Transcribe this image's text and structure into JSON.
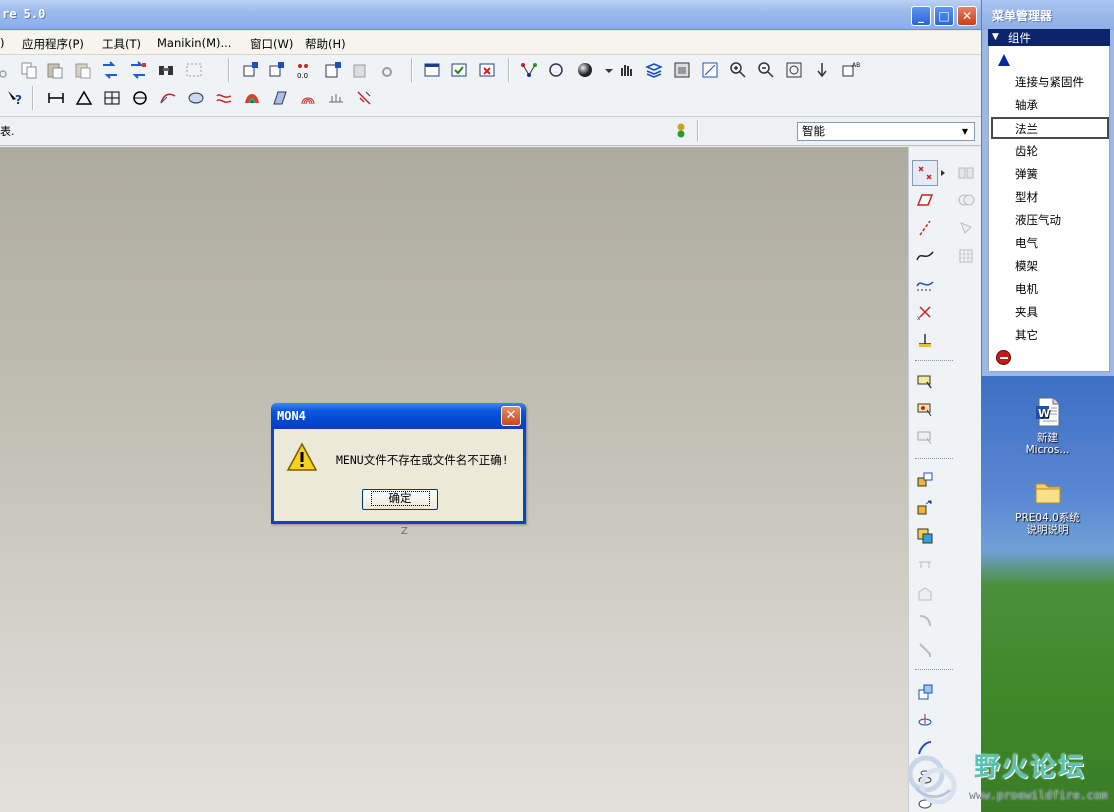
{
  "window": {
    "title": "re 5.0",
    "minimize": "_",
    "maximize": "□",
    "close": "✕"
  },
  "menubar": {
    "items": [
      ")",
      "应用程序(P)",
      "工具(T)",
      "Manikin(M)...",
      "窗口(W)",
      "帮助(H)"
    ]
  },
  "status": {
    "message": "表.",
    "filter_value": "智能"
  },
  "graphics": {
    "axis_label": "Z"
  },
  "dialog": {
    "title": "MON4",
    "message": "MENU文件不存在或文件名不正确!",
    "ok_label": "确定",
    "close": "✕"
  },
  "menu_manager": {
    "title": "菜单管理器",
    "header": "组件",
    "items": [
      "连接与紧固件",
      "轴承",
      "法兰",
      "齿轮",
      "弹簧",
      "型材",
      "液压气动",
      "电气",
      "模架",
      "电机",
      "夹具",
      "其它"
    ],
    "selected": "法兰"
  },
  "desktop": {
    "icons": [
      {
        "label_line1": "新建",
        "label_line2": "Micros...",
        "icon": "word-document-icon"
      },
      {
        "label_line1": "PRE04.0系统",
        "label_line2": "说明说明",
        "icon": "folder-icon"
      }
    ]
  },
  "watermark": {
    "title": "野火论坛",
    "url": "www.proewildfire.com"
  },
  "colors": {
    "titlebar": "#0a58e0",
    "menu_header": "#0c246c",
    "watermark": "#57c3b4"
  }
}
